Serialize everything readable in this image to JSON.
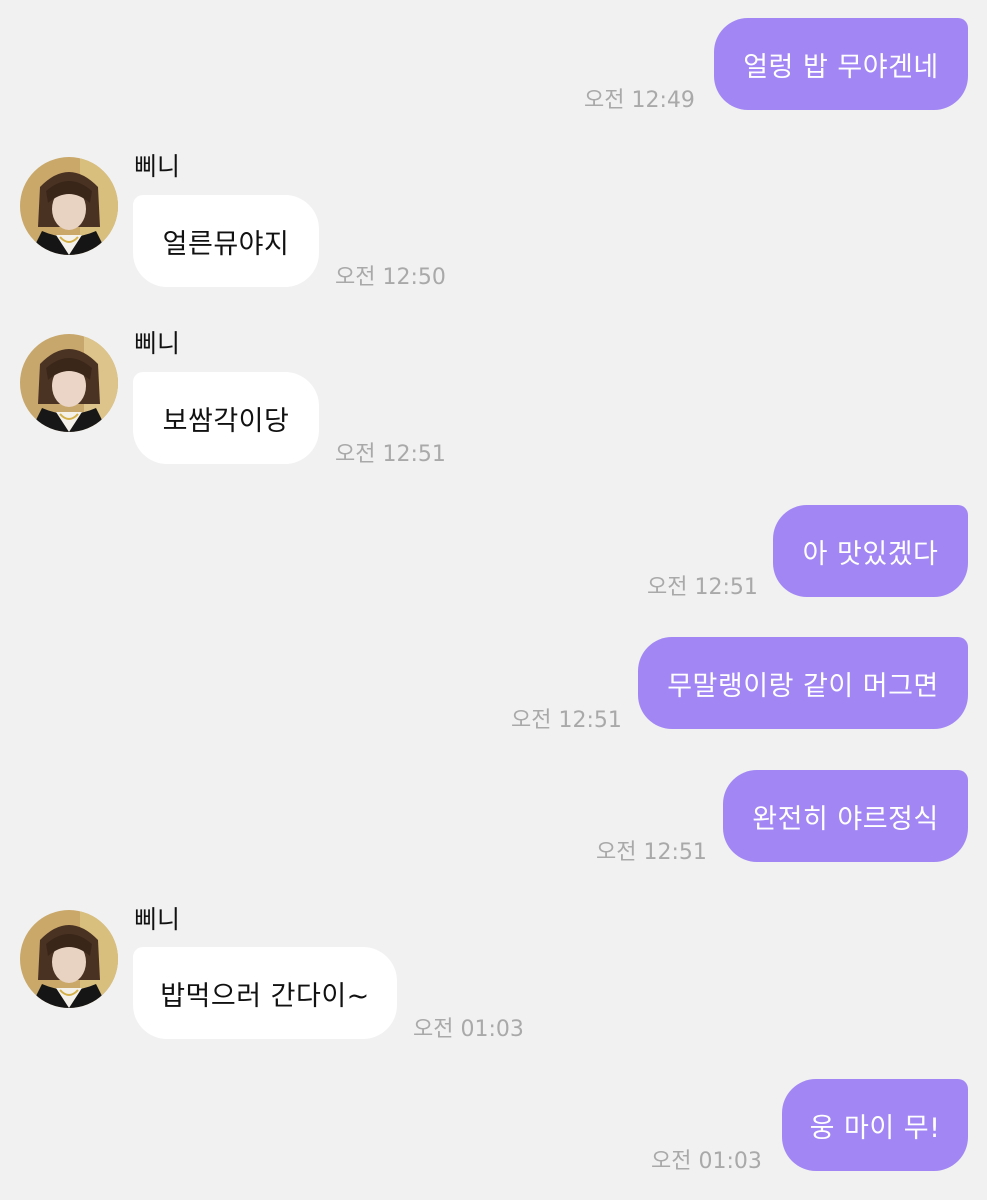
{
  "contact": {
    "name": "삐니"
  },
  "messages": [
    {
      "direction": "outgoing",
      "text": "얼렁 밥 무야겐네",
      "time": "오전 12:49"
    },
    {
      "direction": "incoming",
      "sender": "삐니",
      "text": "얼른뮤야지",
      "time": "오전 12:50"
    },
    {
      "direction": "incoming",
      "sender": "삐니",
      "text": "보쌈각이당",
      "time": "오전 12:51"
    },
    {
      "direction": "outgoing",
      "text": "아 맛있겠다",
      "time": "오전 12:51"
    },
    {
      "direction": "outgoing",
      "text": "무말랭이랑 같이 머그면",
      "time": "오전 12:51"
    },
    {
      "direction": "outgoing",
      "text": "완전히 야르정식",
      "time": "오전 12:51"
    },
    {
      "direction": "incoming",
      "sender": "삐니",
      "text": "밥먹으러 간다이~",
      "time": "오전 01:03"
    },
    {
      "direction": "outgoing",
      "text": "웅 마이 무!",
      "time": "오전 01:03"
    }
  ],
  "colors": {
    "background": "#f1f1f1",
    "outgoing_bubble": "#a287f4",
    "incoming_bubble": "#ffffff",
    "timestamp": "#a9a9a9"
  },
  "icons": {
    "avatar": "profile-photo-icon"
  }
}
